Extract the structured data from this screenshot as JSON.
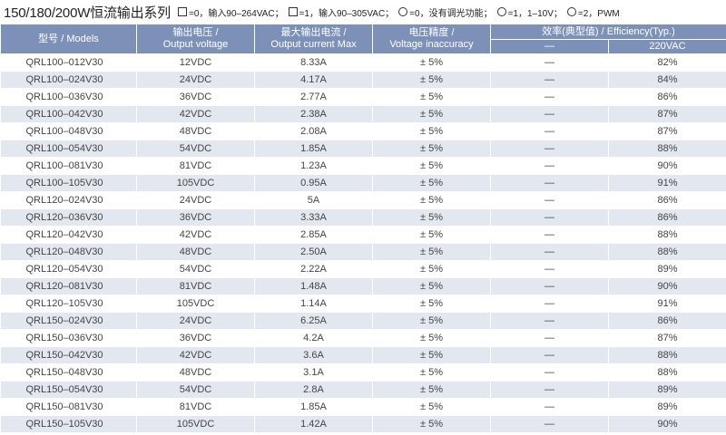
{
  "header": {
    "title": "150/180/200W恒流输出系列",
    "legend": [
      {
        "shape": "square",
        "text": "=0，输入90–264VAC；"
      },
      {
        "shape": "square",
        "text": "=1，输入90–305VAC；"
      },
      {
        "shape": "circle",
        "text": "=0，没有调光功能；"
      },
      {
        "shape": "circle",
        "text": "=1，1–10V；"
      },
      {
        "shape": "circle",
        "text": "=2，PWM"
      }
    ]
  },
  "table": {
    "headers": {
      "model": "型号 / Models",
      "voltage_cn": "输出电压 /",
      "voltage_en": "Output voltage",
      "current_cn": "最大输出电流 /",
      "current_en": "Output current Max",
      "accuracy_cn": "电压精度 /",
      "accuracy_en": "Voltage inaccuracy",
      "efficiency": "效率(典型值) / Efficiency(Typ.)",
      "eff_sub1": "—",
      "eff_sub2": "220VAC"
    },
    "rows": [
      {
        "model": "QRL100–012V30",
        "voltage": "12VDC",
        "current": "8.33A",
        "accuracy": "± 5%",
        "dash": "—",
        "eff": "82%"
      },
      {
        "model": "QRL100–024V30",
        "voltage": "24VDC",
        "current": "4.17A",
        "accuracy": "± 5%",
        "dash": "—",
        "eff": "84%"
      },
      {
        "model": "QRL100–036V30",
        "voltage": "36VDC",
        "current": "2.77A",
        "accuracy": "± 5%",
        "dash": "—",
        "eff": "86%"
      },
      {
        "model": "QRL100–042V30",
        "voltage": "42VDC",
        "current": "2.38A",
        "accuracy": "± 5%",
        "dash": "—",
        "eff": "87%"
      },
      {
        "model": "QRL100–048V30",
        "voltage": "48VDC",
        "current": "2.08A",
        "accuracy": "± 5%",
        "dash": "—",
        "eff": "87%"
      },
      {
        "model": "QRL100–054V30",
        "voltage": "54VDC",
        "current": "1.85A",
        "accuracy": "± 5%",
        "dash": "—",
        "eff": "88%"
      },
      {
        "model": "QRL100–081V30",
        "voltage": "81VDC",
        "current": "1.23A",
        "accuracy": "± 5%",
        "dash": "—",
        "eff": "90%"
      },
      {
        "model": "QRL100–105V30",
        "voltage": "105VDC",
        "current": "0.95A",
        "accuracy": "± 5%",
        "dash": "—",
        "eff": "91%"
      },
      {
        "model": "QRL120–024V30",
        "voltage": "24VDC",
        "current": "5A",
        "accuracy": "± 5%",
        "dash": "—",
        "eff": "86%"
      },
      {
        "model": "QRL120–036V30",
        "voltage": "36VDC",
        "current": "3.33A",
        "accuracy": "± 5%",
        "dash": "—",
        "eff": "86%"
      },
      {
        "model": "QRL120–042V30",
        "voltage": "42VDC",
        "current": "2.85A",
        "accuracy": "± 5%",
        "dash": "—",
        "eff": "88%"
      },
      {
        "model": "QRL120–048V30",
        "voltage": "48VDC",
        "current": "2.50A",
        "accuracy": "± 5%",
        "dash": "—",
        "eff": "88%"
      },
      {
        "model": "QRL120–054V30",
        "voltage": "54VDC",
        "current": "2.22A",
        "accuracy": "± 5%",
        "dash": "—",
        "eff": "89%"
      },
      {
        "model": "QRL120–081V30",
        "voltage": "81VDC",
        "current": "1.48A",
        "accuracy": "± 5%",
        "dash": "—",
        "eff": "90%"
      },
      {
        "model": "QRL120–105V30",
        "voltage": "105VDC",
        "current": "1.14A",
        "accuracy": "± 5%",
        "dash": "—",
        "eff": "91%"
      },
      {
        "model": "QRL150–024V30",
        "voltage": "24VDC",
        "current": "6.25A",
        "accuracy": "± 5%",
        "dash": "—",
        "eff": "86%"
      },
      {
        "model": "QRL150–036V30",
        "voltage": "36VDC",
        "current": "4.2A",
        "accuracy": "± 5%",
        "dash": "—",
        "eff": "87%"
      },
      {
        "model": "QRL150–042V30",
        "voltage": "42VDC",
        "current": "3.6A",
        "accuracy": "± 5%",
        "dash": "—",
        "eff": "88%"
      },
      {
        "model": "QRL150–048V30",
        "voltage": "48VDC",
        "current": "3.1A",
        "accuracy": "± 5%",
        "dash": "—",
        "eff": "88%"
      },
      {
        "model": "QRL150–054V30",
        "voltage": "54VDC",
        "current": "2.8A",
        "accuracy": "± 5%",
        "dash": "—",
        "eff": "89%"
      },
      {
        "model": "QRL150–081V30",
        "voltage": "81VDC",
        "current": "1.85A",
        "accuracy": "± 5%",
        "dash": "—",
        "eff": "89%"
      },
      {
        "model": "QRL150–105V30",
        "voltage": "105VDC",
        "current": "1.42A",
        "accuracy": "± 5%",
        "dash": "—",
        "eff": "90%"
      }
    ]
  }
}
